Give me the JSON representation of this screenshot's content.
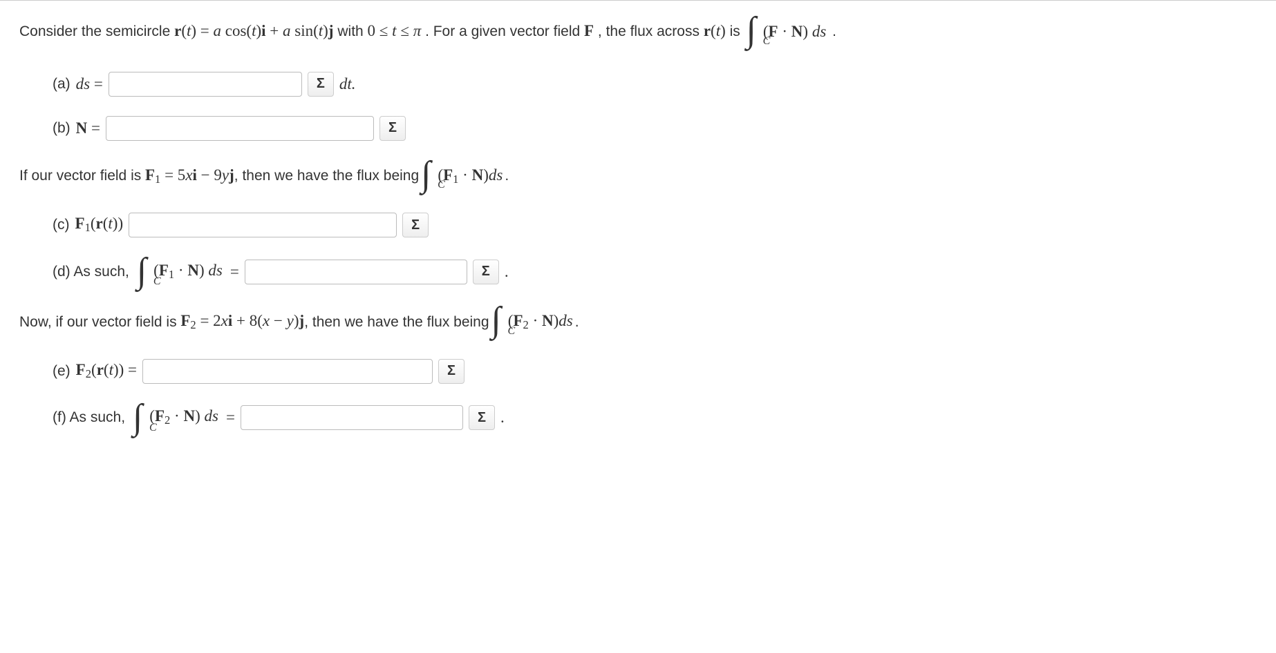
{
  "intro": {
    "prefix": "Consider the semicircle ",
    "rt_eq": "r(t) = a cos(t)i + a sin(t)j",
    "with": " with ",
    "range": "0 ≤ t ≤ π",
    "mid": ". For a given vector field ",
    "F": "F",
    "mid2": ", the flux across ",
    "rt": "r(t)",
    "is": " is ",
    "integral_sub": "C",
    "integrand": "(F · N) ds",
    "period": "."
  },
  "a": {
    "label": "(a) ",
    "lhs": "ds = ",
    "after": "dt."
  },
  "b": {
    "label": "(b) ",
    "lhs": "N = "
  },
  "para1": {
    "prefix": "If our vector field is ",
    "F1eq": "F₁ = 5xi − 9yj",
    "mid": ", then we have the flux being ",
    "integral_sub": "C",
    "integrand": "(F₁ · N)ds",
    "period": "."
  },
  "c": {
    "label": "(c) ",
    "lhs": "F₁(r(t))"
  },
  "d": {
    "label": "(d) As such, ",
    "integral_sub": "C",
    "integrand": "(F₁ · N) ds",
    "eq": " = ",
    "period": "."
  },
  "para2": {
    "prefix": "Now, if our vector field is ",
    "F2eq": "F₂ = 2xi + 8(x − y)j",
    "mid": ", then we have the flux being ",
    "integral_sub": "C",
    "integrand": "(F₂ · N)ds",
    "period": "."
  },
  "e": {
    "label": "(e) ",
    "lhs": "F₂(r(t)) = "
  },
  "f": {
    "label": "(f) As such, ",
    "integral_sub": "C",
    "integrand": "(F₂ · N) ds",
    "eq": " = ",
    "period": "."
  },
  "sigma": "Σ"
}
